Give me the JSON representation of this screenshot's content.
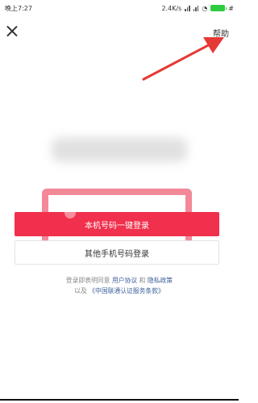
{
  "status_bar": {
    "time": "晚上7:27",
    "network_speed": "2.4K/s",
    "extra_icon": "#"
  },
  "topbar": {
    "help_label": "帮助"
  },
  "login": {
    "one_click_label": "本机号码一键登录",
    "other_phone_label": "其他手机号码登录"
  },
  "agreement": {
    "prefix": "登录即表明同意",
    "user_agreement": "用户协议",
    "and": "和",
    "privacy_policy": "隐私政策",
    "with": "以及",
    "carrier_terms": "《中国联通认证服务条款》"
  },
  "colors": {
    "primary": "#f0304c",
    "highlight": "#ee5a70",
    "link": "#3b5f98",
    "annotation_arrow": "#e53935"
  }
}
